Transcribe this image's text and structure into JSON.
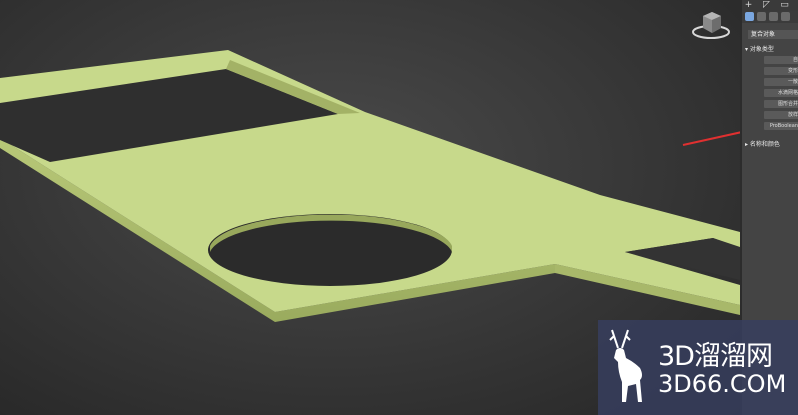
{
  "command_panel": {
    "tabs": [
      "+",
      "◸",
      "▭"
    ],
    "category_dropdown": "复合对象",
    "rollout_object_type": "对象类型",
    "rollout_name_color": "名称和颜色",
    "buttons": [
      "自",
      "变形",
      "一散",
      "水滴网格",
      "图形合并",
      "放样",
      "ProBoolean"
    ]
  },
  "watermark": {
    "brand_cn": "3D溜溜网",
    "domain": "3D66.COM"
  },
  "colors": {
    "model": "#c7d98b",
    "model_edge": "#a9b86b",
    "annotation_arrow": "#e03030"
  }
}
